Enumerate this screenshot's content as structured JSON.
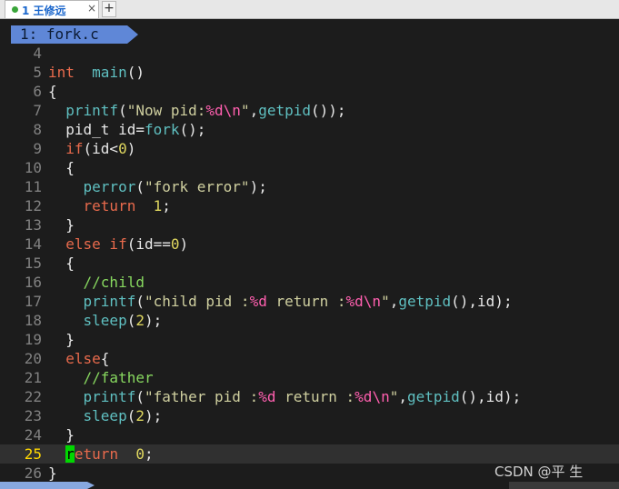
{
  "tabbar": {
    "tab_title": "1 王修远",
    "close_glyph": "×",
    "add_glyph": "+"
  },
  "buffer": {
    "label": "1: fork.c"
  },
  "editor": {
    "current_line": 25,
    "lines": [
      {
        "n": "4",
        "tokens": []
      },
      {
        "n": "5",
        "tokens": [
          [
            "kw",
            "int"
          ],
          [
            "",
            "  "
          ],
          [
            "fn",
            "main"
          ],
          [
            "",
            "()"
          ]
        ]
      },
      {
        "n": "6",
        "tokens": [
          [
            "",
            "{"
          ]
        ]
      },
      {
        "n": "7",
        "tokens": [
          [
            "",
            "  "
          ],
          [
            "fn",
            "printf"
          ],
          [
            "",
            "("
          ],
          [
            "str",
            "\"Now pid:"
          ],
          [
            "esc",
            "%d\\n"
          ],
          [
            "str",
            "\""
          ],
          [
            "",
            ","
          ],
          [
            "fn",
            "getpid"
          ],
          [
            "",
            "());"
          ]
        ]
      },
      {
        "n": "8",
        "tokens": [
          [
            "",
            "  pid_t id="
          ],
          [
            "fn",
            "fork"
          ],
          [
            "",
            "();"
          ]
        ]
      },
      {
        "n": "9",
        "tokens": [
          [
            "",
            "  "
          ],
          [
            "kw",
            "if"
          ],
          [
            "",
            "(id<"
          ],
          [
            "num",
            "0"
          ],
          [
            "",
            ")"
          ]
        ]
      },
      {
        "n": "10",
        "tokens": [
          [
            "",
            "  {"
          ]
        ]
      },
      {
        "n": "11",
        "tokens": [
          [
            "",
            "    "
          ],
          [
            "fn",
            "perror"
          ],
          [
            "",
            "("
          ],
          [
            "str",
            "\"fork error\""
          ],
          [
            "",
            ");"
          ]
        ]
      },
      {
        "n": "12",
        "tokens": [
          [
            "",
            "    "
          ],
          [
            "kw",
            "return"
          ],
          [
            "",
            "  "
          ],
          [
            "num",
            "1"
          ],
          [
            "",
            ";"
          ]
        ]
      },
      {
        "n": "13",
        "tokens": [
          [
            "",
            "  }"
          ]
        ]
      },
      {
        "n": "14",
        "tokens": [
          [
            "",
            "  "
          ],
          [
            "kw",
            "else if"
          ],
          [
            "",
            "(id=="
          ],
          [
            "num",
            "0"
          ],
          [
            "",
            ")"
          ]
        ]
      },
      {
        "n": "15",
        "tokens": [
          [
            "",
            "  {"
          ]
        ]
      },
      {
        "n": "16",
        "tokens": [
          [
            "",
            "    "
          ],
          [
            "cmt",
            "//child"
          ]
        ]
      },
      {
        "n": "17",
        "tokens": [
          [
            "",
            "    "
          ],
          [
            "fn",
            "printf"
          ],
          [
            "",
            "("
          ],
          [
            "str",
            "\"child pid :"
          ],
          [
            "esc",
            "%d"
          ],
          [
            "str",
            " return :"
          ],
          [
            "esc",
            "%d\\n"
          ],
          [
            "str",
            "\""
          ],
          [
            "",
            ","
          ],
          [
            "fn",
            "getpid"
          ],
          [
            "",
            "(),id);"
          ]
        ]
      },
      {
        "n": "18",
        "tokens": [
          [
            "",
            "    "
          ],
          [
            "fn",
            "sleep"
          ],
          [
            "",
            "("
          ],
          [
            "num",
            "2"
          ],
          [
            "",
            "); "
          ]
        ]
      },
      {
        "n": "19",
        "tokens": [
          [
            "",
            "  }"
          ]
        ]
      },
      {
        "n": "20",
        "tokens": [
          [
            "",
            "  "
          ],
          [
            "kw",
            "else"
          ],
          [
            "",
            "{"
          ]
        ]
      },
      {
        "n": "21",
        "tokens": [
          [
            "",
            "    "
          ],
          [
            "cmt",
            "//father"
          ]
        ]
      },
      {
        "n": "22",
        "tokens": [
          [
            "",
            "    "
          ],
          [
            "fn",
            "printf"
          ],
          [
            "",
            "("
          ],
          [
            "str",
            "\"father pid :"
          ],
          [
            "esc",
            "%d"
          ],
          [
            "str",
            " return :"
          ],
          [
            "esc",
            "%d\\n"
          ],
          [
            "str",
            "\""
          ],
          [
            "",
            ","
          ],
          [
            "fn",
            "getpid"
          ],
          [
            "",
            "(),id);"
          ]
        ]
      },
      {
        "n": "23",
        "tokens": [
          [
            "",
            "    "
          ],
          [
            "fn",
            "sleep"
          ],
          [
            "",
            "("
          ],
          [
            "num",
            "2"
          ],
          [
            "",
            ");"
          ]
        ]
      },
      {
        "n": "24",
        "tokens": [
          [
            "",
            "  }"
          ]
        ]
      },
      {
        "n": "25",
        "tokens": [
          [
            "",
            "  "
          ],
          [
            "cursor",
            "r"
          ],
          [
            "kw",
            "eturn"
          ],
          [
            "",
            "  "
          ],
          [
            "num",
            "0"
          ],
          [
            "",
            ";"
          ]
        ]
      },
      {
        "n": "26",
        "tokens": [
          [
            "",
            "}"
          ]
        ]
      }
    ]
  },
  "watermark": "CSDN @平  生"
}
